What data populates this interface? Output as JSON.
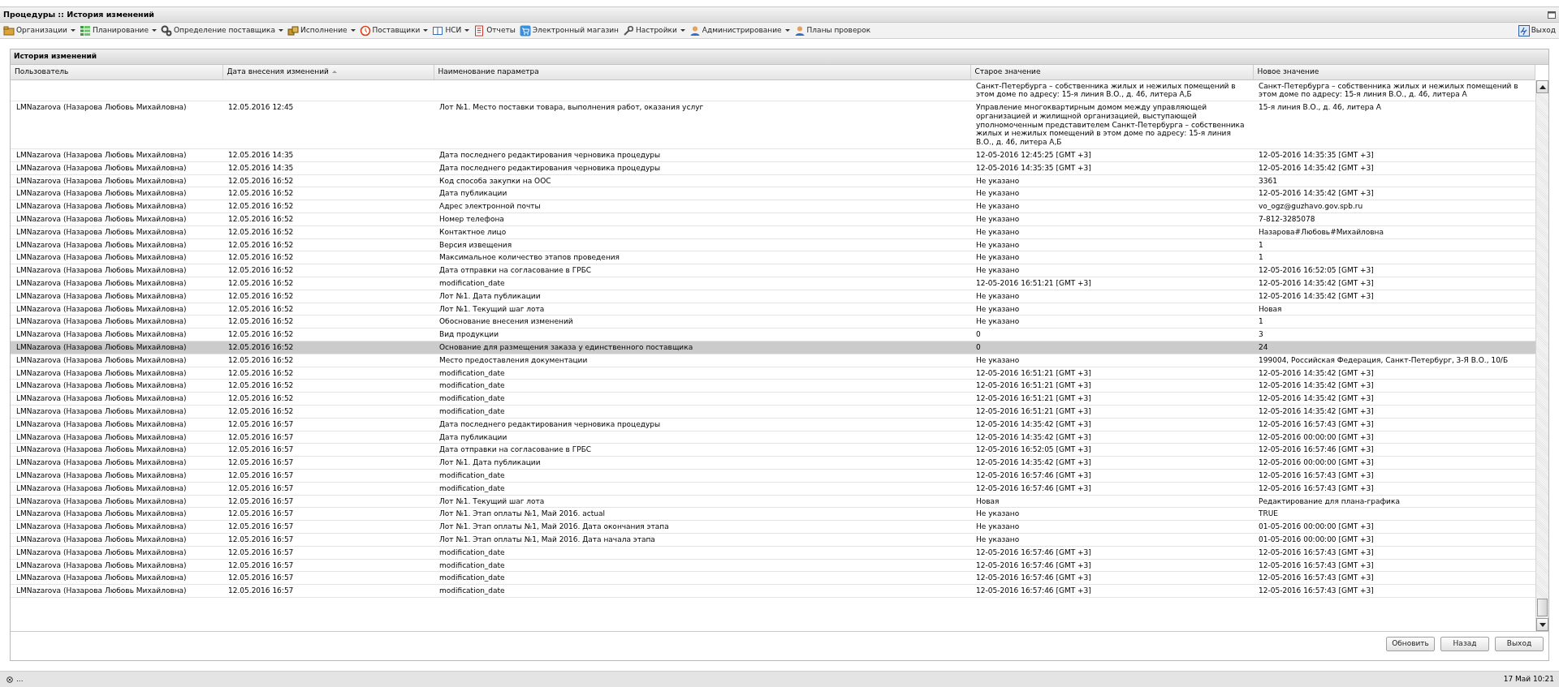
{
  "window": {
    "title": "Процедуры :: История изменений"
  },
  "menu": {
    "items": [
      {
        "label": "Организации",
        "dropdown": true
      },
      {
        "label": "Планирование",
        "dropdown": true
      },
      {
        "label": "Определение поставщика",
        "dropdown": true
      },
      {
        "label": "Исполнение",
        "dropdown": true
      },
      {
        "label": "Поставщики",
        "dropdown": true
      },
      {
        "label": "НСИ",
        "dropdown": true
      },
      {
        "label": "Отчеты",
        "dropdown": false
      },
      {
        "label": "Электронный магазин",
        "dropdown": false
      },
      {
        "label": "Настройки",
        "dropdown": true
      },
      {
        "label": "Администрирование",
        "dropdown": true
      },
      {
        "label": "Планы проверок",
        "dropdown": false
      }
    ],
    "exit": "Выход"
  },
  "panel": {
    "title": "История изменений"
  },
  "table": {
    "columns": [
      {
        "label": "Пользователь",
        "sorted": false
      },
      {
        "label": "Дата внесения изменений",
        "sorted": true
      },
      {
        "label": "Наименование параметра",
        "sorted": false
      },
      {
        "label": "Старое значение",
        "sorted": false
      },
      {
        "label": "Новое значение",
        "sorted": false
      }
    ],
    "rows": [
      {
        "cells": [
          "",
          "",
          "",
          "Санкт-Петербурга – собственника жилых и нежилых помещений в этом доме по адресу: 15-я линия В.О., д. 46, литера А,Б",
          "Санкт-Петербурга – собственника жилых и нежилых помещений в этом доме по адресу: 15-я линия В.О., д. 46, литера А"
        ],
        "selected": false
      },
      {
        "cells": [
          "LMNazarova (Назарова Любовь Михайловна)",
          "12.05.2016 12:45",
          "Лот №1. Место поставки товара, выполнения работ, оказания услуг",
          "Управление многоквартирным домом между управляющей организацией и жилищной организацией, выступающей уполномоченным представителем Санкт-Петербурга – собственника жилых и нежилых помещений в этом доме по адресу: 15-я линия В.О., д. 46, литера А,Б",
          "15-я линия В.О., д. 46, литера А"
        ],
        "selected": false
      },
      {
        "cells": [
          "LMNazarova (Назарова Любовь Михайловна)",
          "12.05.2016 14:35",
          "Дата последнего редактирования черновика процедуры",
          "12-05-2016 12:45:25 [GMT +3]",
          "12-05-2016 14:35:35 [GMT +3]"
        ],
        "selected": false
      },
      {
        "cells": [
          "LMNazarova (Назарова Любовь Михайловна)",
          "12.05.2016 14:35",
          "Дата последнего редактирования черновика процедуры",
          "12-05-2016 14:35:35 [GMT +3]",
          "12-05-2016 14:35:42 [GMT +3]"
        ],
        "selected": false
      },
      {
        "cells": [
          "LMNazarova (Назарова Любовь Михайловна)",
          "12.05.2016 16:52",
          "Код способа закупки на ООС",
          "Не указано",
          "3361"
        ],
        "selected": false
      },
      {
        "cells": [
          "LMNazarova (Назарова Любовь Михайловна)",
          "12.05.2016 16:52",
          "Дата публикации",
          "Не указано",
          "12-05-2016 14:35:42 [GMT +3]"
        ],
        "selected": false
      },
      {
        "cells": [
          "LMNazarova (Назарова Любовь Михайловна)",
          "12.05.2016 16:52",
          "Адрес электронной почты",
          "Не указано",
          "vo_ogz@guzhavo.gov.spb.ru"
        ],
        "selected": false
      },
      {
        "cells": [
          "LMNazarova (Назарова Любовь Михайловна)",
          "12.05.2016 16:52",
          "Номер телефона",
          "Не указано",
          "7-812-3285078"
        ],
        "selected": false
      },
      {
        "cells": [
          "LMNazarova (Назарова Любовь Михайловна)",
          "12.05.2016 16:52",
          "Контактное лицо",
          "Не указано",
          "Назарова#Любовь#Михайловна"
        ],
        "selected": false
      },
      {
        "cells": [
          "LMNazarova (Назарова Любовь Михайловна)",
          "12.05.2016 16:52",
          "Версия извещения",
          "Не указано",
          "1"
        ],
        "selected": false
      },
      {
        "cells": [
          "LMNazarova (Назарова Любовь Михайловна)",
          "12.05.2016 16:52",
          "Максимальное количество этапов проведения",
          "Не указано",
          "1"
        ],
        "selected": false
      },
      {
        "cells": [
          "LMNazarova (Назарова Любовь Михайловна)",
          "12.05.2016 16:52",
          "Дата отправки на согласование в ГРБС",
          "Не указано",
          "12-05-2016 16:52:05 [GMT +3]"
        ],
        "selected": false
      },
      {
        "cells": [
          "LMNazarova (Назарова Любовь Михайловна)",
          "12.05.2016 16:52",
          "modification_date",
          "12-05-2016 16:51:21 [GMT +3]",
          "12-05-2016 14:35:42 [GMT +3]"
        ],
        "selected": false
      },
      {
        "cells": [
          "LMNazarova (Назарова Любовь Михайловна)",
          "12.05.2016 16:52",
          "Лот №1. Дата публикации",
          "Не указано",
          "12-05-2016 14:35:42 [GMT +3]"
        ],
        "selected": false
      },
      {
        "cells": [
          "LMNazarova (Назарова Любовь Михайловна)",
          "12.05.2016 16:52",
          "Лот №1. Текущий шаг лота",
          "Не указано",
          "Новая"
        ],
        "selected": false
      },
      {
        "cells": [
          "LMNazarova (Назарова Любовь Михайловна)",
          "12.05.2016 16:52",
          "Обоснование внесения изменений",
          "Не указано",
          "1"
        ],
        "selected": false
      },
      {
        "cells": [
          "LMNazarova (Назарова Любовь Михайловна)",
          "12.05.2016 16:52",
          "Вид продукции",
          "0",
          "3"
        ],
        "selected": false
      },
      {
        "cells": [
          "LMNazarova (Назарова Любовь Михайловна)",
          "12.05.2016 16:52",
          "Основание для размещения заказа у единственного поставщика",
          "0",
          "24"
        ],
        "selected": true
      },
      {
        "cells": [
          "LMNazarova (Назарова Любовь Михайловна)",
          "12.05.2016 16:52",
          "Место предоставления документации",
          "Не указано",
          "199004, Российская Федерация, Санкт-Петербург, 3-Я В.О., 10/Б"
        ],
        "selected": false
      },
      {
        "cells": [
          "LMNazarova (Назарова Любовь Михайловна)",
          "12.05.2016 16:52",
          "modification_date",
          "12-05-2016 16:51:21 [GMT +3]",
          "12-05-2016 14:35:42 [GMT +3]"
        ],
        "selected": false
      },
      {
        "cells": [
          "LMNazarova (Назарова Любовь Михайловна)",
          "12.05.2016 16:52",
          "modification_date",
          "12-05-2016 16:51:21 [GMT +3]",
          "12-05-2016 14:35:42 [GMT +3]"
        ],
        "selected": false
      },
      {
        "cells": [
          "LMNazarova (Назарова Любовь Михайловна)",
          "12.05.2016 16:52",
          "modification_date",
          "12-05-2016 16:51:21 [GMT +3]",
          "12-05-2016 14:35:42 [GMT +3]"
        ],
        "selected": false
      },
      {
        "cells": [
          "LMNazarova (Назарова Любовь Михайловна)",
          "12.05.2016 16:52",
          "modification_date",
          "12-05-2016 16:51:21 [GMT +3]",
          "12-05-2016 14:35:42 [GMT +3]"
        ],
        "selected": false
      },
      {
        "cells": [
          "LMNazarova (Назарова Любовь Михайловна)",
          "12.05.2016 16:57",
          "Дата последнего редактирования черновика процедуры",
          "12-05-2016 14:35:42 [GMT +3]",
          "12-05-2016 16:57:43 [GMT +3]"
        ],
        "selected": false
      },
      {
        "cells": [
          "LMNazarova (Назарова Любовь Михайловна)",
          "12.05.2016 16:57",
          "Дата публикации",
          "12-05-2016 14:35:42 [GMT +3]",
          "12-05-2016 00:00:00 [GMT +3]"
        ],
        "selected": false
      },
      {
        "cells": [
          "LMNazarova (Назарова Любовь Михайловна)",
          "12.05.2016 16:57",
          "Дата отправки на согласование в ГРБС",
          "12-05-2016 16:52:05 [GMT +3]",
          "12-05-2016 16:57:46 [GMT +3]"
        ],
        "selected": false
      },
      {
        "cells": [
          "LMNazarova (Назарова Любовь Михайловна)",
          "12.05.2016 16:57",
          "Лот №1. Дата публикации",
          "12-05-2016 14:35:42 [GMT +3]",
          "12-05-2016 00:00:00 [GMT +3]"
        ],
        "selected": false
      },
      {
        "cells": [
          "LMNazarova (Назарова Любовь Михайловна)",
          "12.05.2016 16:57",
          "modification_date",
          "12-05-2016 16:57:46 [GMT +3]",
          "12-05-2016 16:57:43 [GMT +3]"
        ],
        "selected": false
      },
      {
        "cells": [
          "LMNazarova (Назарова Любовь Михайловна)",
          "12.05.2016 16:57",
          "modification_date",
          "12-05-2016 16:57:46 [GMT +3]",
          "12-05-2016 16:57:43 [GMT +3]"
        ],
        "selected": false
      },
      {
        "cells": [
          "LMNazarova (Назарова Любовь Михайловна)",
          "12.05.2016 16:57",
          "Лот №1. Текущий шаг лота",
          "Новая",
          "Редактирование для плана-графика"
        ],
        "selected": false
      },
      {
        "cells": [
          "LMNazarova (Назарова Любовь Михайловна)",
          "12.05.2016 16:57",
          "Лот №1. Этап оплаты №1, Май 2016. actual",
          "Не указано",
          "TRUE"
        ],
        "selected": false
      },
      {
        "cells": [
          "LMNazarova (Назарова Любовь Михайловна)",
          "12.05.2016 16:57",
          "Лот №1. Этап оплаты №1, Май 2016. Дата окончания этапа",
          "Не указано",
          "01-05-2016 00:00:00 [GMT +3]"
        ],
        "selected": false
      },
      {
        "cells": [
          "LMNazarova (Назарова Любовь Михайловна)",
          "12.05.2016 16:57",
          "Лот №1. Этап оплаты №1, Май 2016. Дата начала этапа",
          "Не указано",
          "01-05-2016 00:00:00 [GMT +3]"
        ],
        "selected": false
      },
      {
        "cells": [
          "LMNazarova (Назарова Любовь Михайловна)",
          "12.05.2016 16:57",
          "modification_date",
          "12-05-2016 16:57:46 [GMT +3]",
          "12-05-2016 16:57:43 [GMT +3]"
        ],
        "selected": false
      },
      {
        "cells": [
          "LMNazarova (Назарова Любовь Михайловна)",
          "12.05.2016 16:57",
          "modification_date",
          "12-05-2016 16:57:46 [GMT +3]",
          "12-05-2016 16:57:43 [GMT +3]"
        ],
        "selected": false
      },
      {
        "cells": [
          "LMNazarova (Назарова Любовь Михайловна)",
          "12.05.2016 16:57",
          "modification_date",
          "12-05-2016 16:57:46 [GMT +3]",
          "12-05-2016 16:57:43 [GMT +3]"
        ],
        "selected": false
      },
      {
        "cells": [
          "LMNazarova (Назарова Любовь Михайловна)",
          "12.05.2016 16:57",
          "modification_date",
          "12-05-2016 16:57:46 [GMT +3]",
          "12-05-2016 16:57:43 [GMT +3]"
        ],
        "selected": false
      }
    ]
  },
  "buttons": [
    "Обновить",
    "Назад",
    "Выход"
  ],
  "status_bar": {
    "left": "...",
    "right": "17 Май 10:21"
  }
}
